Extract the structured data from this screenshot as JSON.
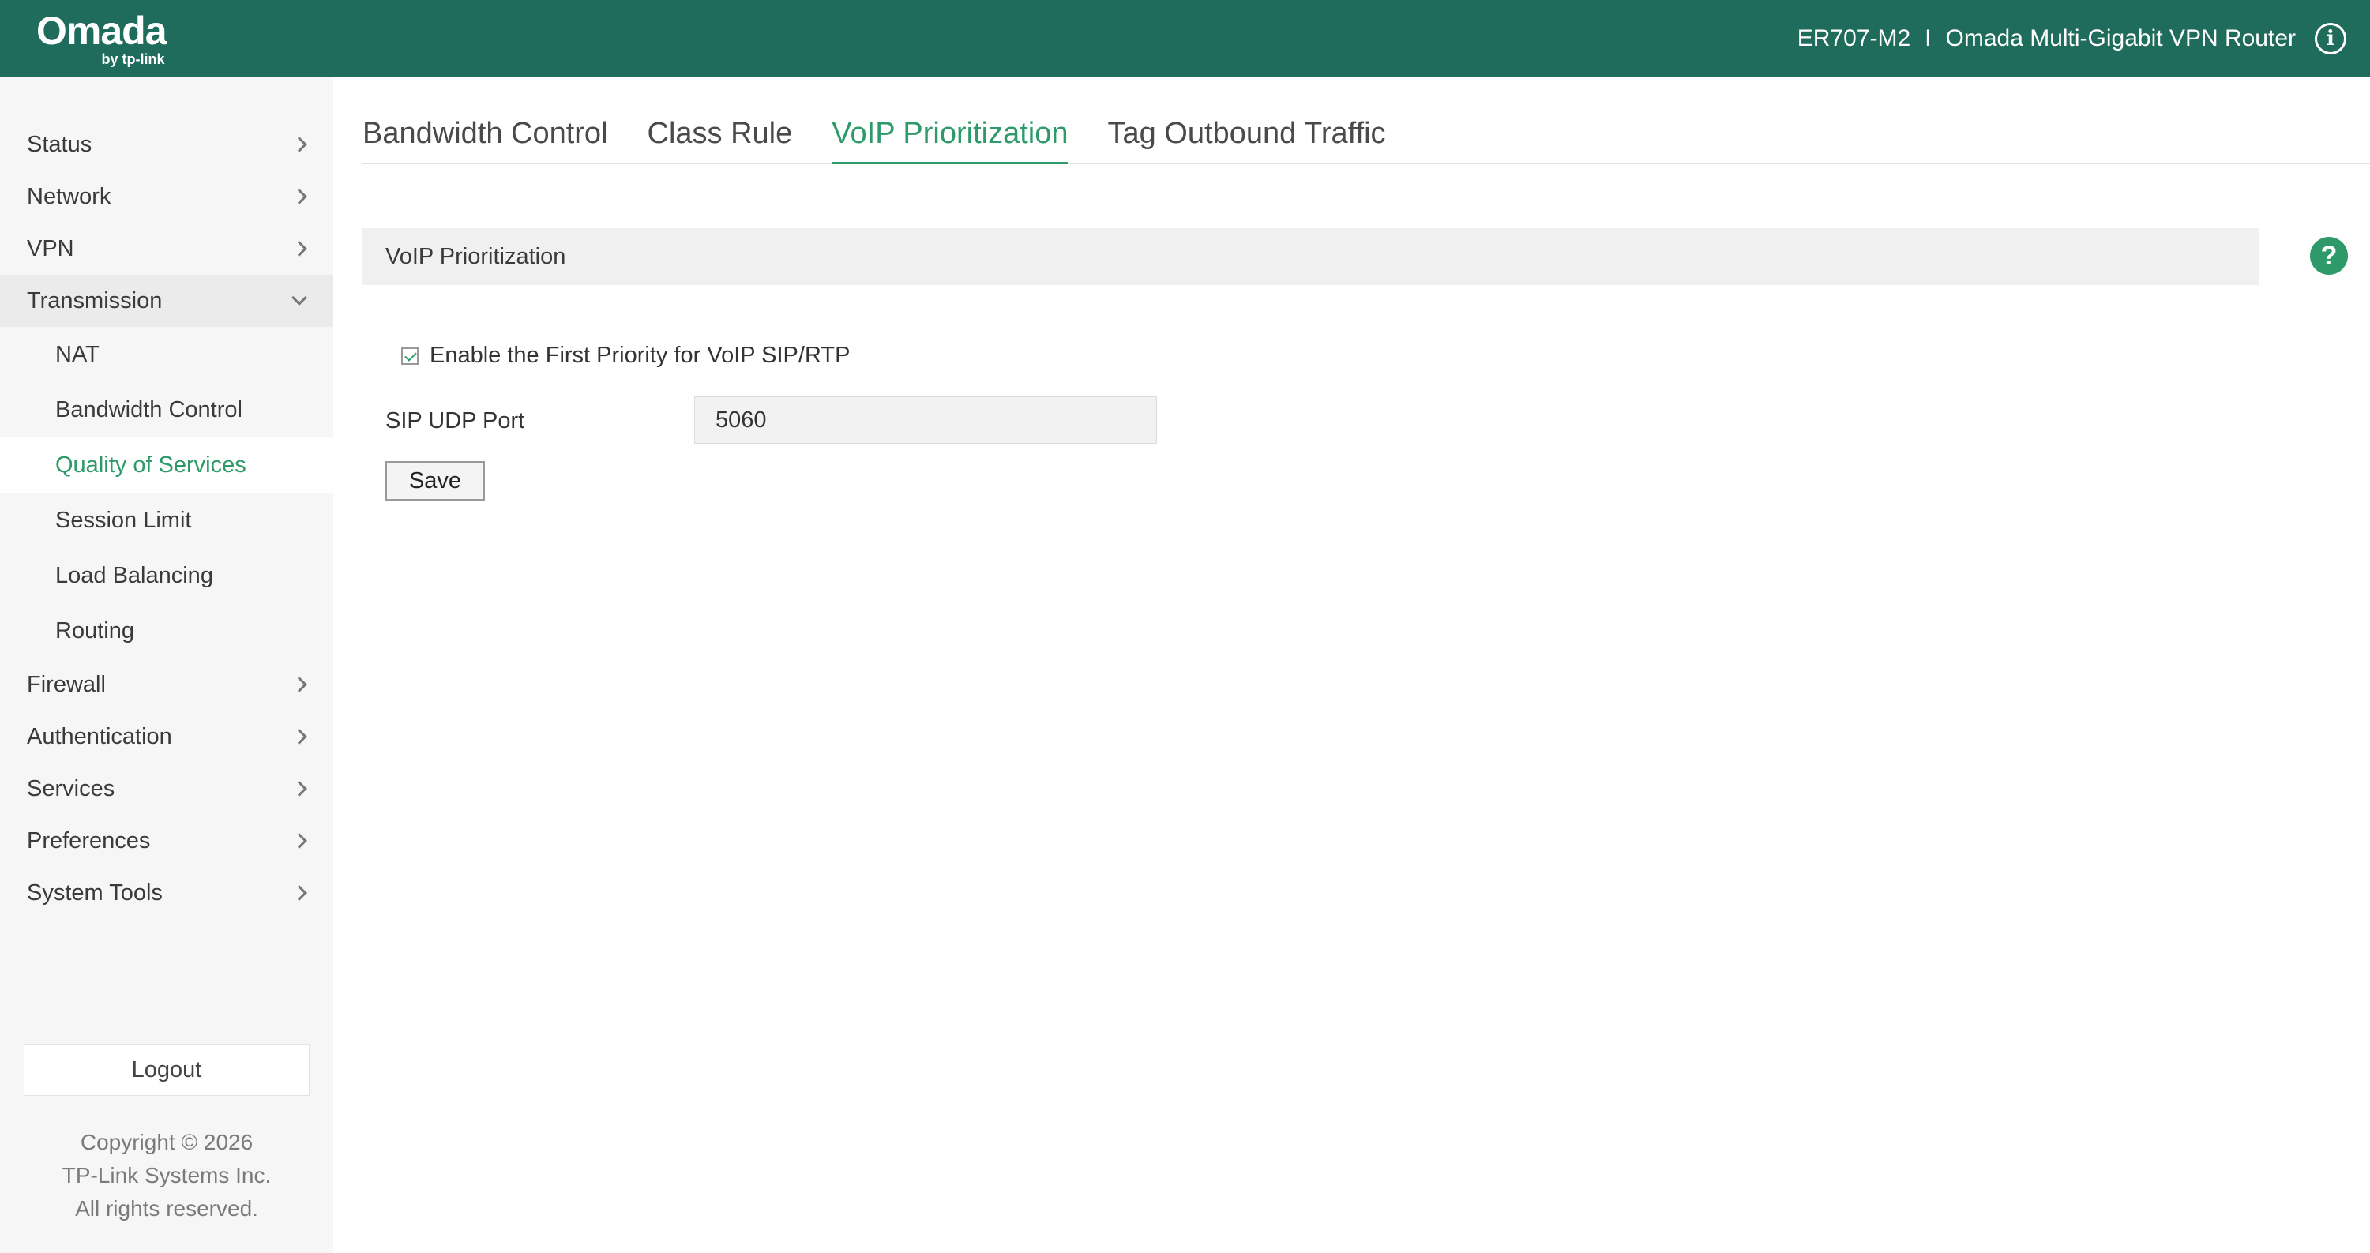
{
  "header": {
    "logo_main": "Omada",
    "logo_sub": "by tp-link",
    "model": "ER707-M2",
    "separator": "I",
    "product": "Omada Multi-Gigabit VPN Router",
    "info_icon": "info-icon"
  },
  "sidebar": {
    "items": [
      {
        "label": "Status"
      },
      {
        "label": "Network"
      },
      {
        "label": "VPN"
      },
      {
        "label": "Transmission"
      }
    ],
    "sub_items": [
      {
        "label": "NAT"
      },
      {
        "label": "Bandwidth Control"
      },
      {
        "label": "Quality of Services"
      },
      {
        "label": "Session Limit"
      },
      {
        "label": "Load Balancing"
      },
      {
        "label": "Routing"
      }
    ],
    "items_after": [
      {
        "label": "Firewall"
      },
      {
        "label": "Authentication"
      },
      {
        "label": "Services"
      },
      {
        "label": "Preferences"
      },
      {
        "label": "System Tools"
      }
    ],
    "logout_label": "Logout",
    "copyright": [
      "Copyright  © 2026",
      "TP-Link Systems Inc.",
      "All rights reserved."
    ]
  },
  "tabs": [
    {
      "label": "Bandwidth Control"
    },
    {
      "label": "Class Rule"
    },
    {
      "label": "VoIP Prioritization",
      "active": true
    },
    {
      "label": "Tag Outbound Traffic"
    }
  ],
  "section": {
    "title": "VoIP Prioritization",
    "help_icon": "?",
    "enable_label": "Enable the First Priority for VoIP SIP/RTP",
    "enable_checked": true,
    "port_label": "SIP UDP Port",
    "port_value": "5060",
    "save_label": "Save"
  },
  "colors": {
    "header_bg": "#1f6b5c",
    "accent": "#2e9a6a"
  }
}
